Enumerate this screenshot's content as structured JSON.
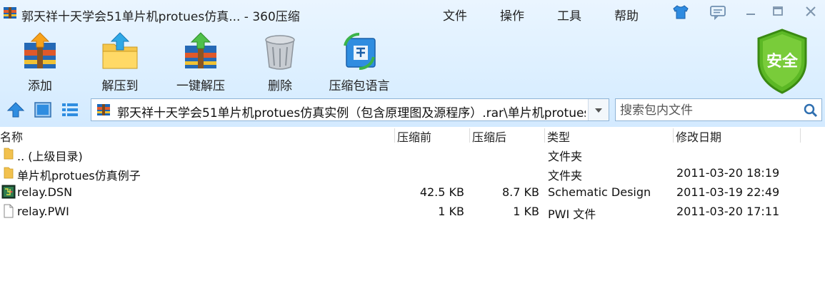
{
  "window": {
    "title": "郭天祥十天学会51单片机protues仿真... - 360压缩"
  },
  "menu": {
    "file": "文件",
    "operate": "操作",
    "tools": "工具",
    "help": "帮助"
  },
  "toolbar": {
    "add": "添加",
    "extract_to": "解压到",
    "one_click_extract": "一键解压",
    "delete": "删除",
    "language": "压缩包语言"
  },
  "security_badge": "安全",
  "address": {
    "path": "郭天祥十天学会51单片机protues仿真实例（包含原理图及源程序）.rar\\单片机protues仿真例子"
  },
  "search": {
    "placeholder": "搜索包内文件"
  },
  "columns": {
    "name": "名称",
    "packed": "压缩前",
    "compressed": "压缩后",
    "type": "类型",
    "modified": "修改日期"
  },
  "files": [
    {
      "name": ".. (上级目录)",
      "packed": "",
      "compressed": "",
      "type": "文件夹",
      "modified": ""
    },
    {
      "name": "单片机protues仿真例子",
      "packed": "",
      "compressed": "",
      "type": "文件夹",
      "modified": "2011-03-20 18:19"
    },
    {
      "name": "relay.DSN",
      "packed": "42.5 KB",
      "compressed": "8.7 KB",
      "type": "Schematic Design",
      "modified": "2011-03-19 22:49"
    },
    {
      "name": "relay.PWI",
      "packed": "1 KB",
      "compressed": "1 KB",
      "type": "PWI 文件",
      "modified": "2011-03-20 17:11"
    }
  ],
  "icons": {
    "app": "archive-icon",
    "skin": "tshirt-icon",
    "feedback": "feedback-icon",
    "minimize": "minimize-icon",
    "maximize": "maximize-icon",
    "close": "close-icon",
    "up": "arrow-up-icon",
    "thumb_view": "thumbnail-view-icon",
    "list_view": "list-view-icon",
    "search": "magnifier-icon"
  },
  "colors": {
    "chrome_bg": "#dcefff",
    "accent_blue": "#1f7fd9",
    "shield_green": "#4daa1a"
  }
}
